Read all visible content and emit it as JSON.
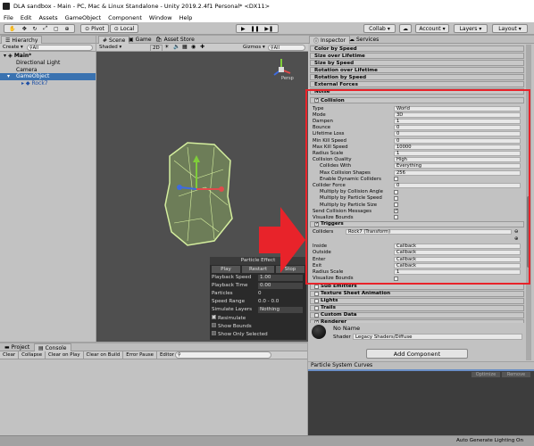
{
  "window_title": "DLA sandbox - Main - PC, Mac & Linux Standalone - Unity 2019.2.4f1 Personal* <DX11>",
  "menu": [
    "File",
    "Edit",
    "Assets",
    "GameObject",
    "Component",
    "Window",
    "Help"
  ],
  "toolbar": {
    "pivot": "Pivot",
    "local": "Local",
    "collab": "Collab",
    "account": "Account",
    "layers": "Layers",
    "layout": "Layout"
  },
  "hierarchy": {
    "tab": "Hierarchy",
    "create": "Create",
    "search": "All",
    "scene": "Main*",
    "items": [
      "Directional Light",
      "Camera",
      "GameObject",
      "Rock7"
    ]
  },
  "scene_tabs": {
    "scene": "Scene",
    "game": "Game",
    "asset_store": "Asset Store",
    "shaded": "Shaded",
    "mode": "2D",
    "gizmos": "Gizmos",
    "search": "All",
    "persp": "Persp"
  },
  "particle_panel": {
    "title": "Particle Effect",
    "play": "Play",
    "restart": "Restart",
    "stop": "Stop",
    "rows": [
      {
        "label": "Playback Speed",
        "value": "1.00"
      },
      {
        "label": "Playback Time",
        "value": "0.00"
      },
      {
        "label": "Particles",
        "value": "0"
      },
      {
        "label": "Speed Range",
        "value": "0.0 - 0.0"
      },
      {
        "label": "Simulate Layers",
        "value": "Nothing"
      }
    ],
    "checks": [
      {
        "label": "Resimulate",
        "on": true
      },
      {
        "label": "Show Bounds",
        "on": false
      },
      {
        "label": "Show Only Selected",
        "on": false
      }
    ]
  },
  "inspector": {
    "tab": "Inspector",
    "services": "Services",
    "modules_top": [
      "Color by Speed",
      "Size over Lifetime",
      "Size by Speed",
      "Rotation over Lifetime",
      "Rotation by Speed",
      "External Forces",
      "Noise"
    ],
    "collision_title": "Collision",
    "collision_rows": [
      {
        "label": "Type",
        "value": "World"
      },
      {
        "label": "Mode",
        "value": "3D"
      },
      {
        "label": "Dampen",
        "value": "1"
      },
      {
        "label": "Bounce",
        "value": "0"
      },
      {
        "label": "Lifetime Loss",
        "value": "0"
      },
      {
        "label": "Min Kill Speed",
        "value": "0"
      },
      {
        "label": "Max Kill Speed",
        "value": "10000"
      },
      {
        "label": "Radius Scale",
        "value": "1"
      },
      {
        "label": "Collision Quality",
        "value": "High"
      },
      {
        "label": "Collides With",
        "value": "Everything"
      },
      {
        "label": "Max Collision Shapes",
        "value": "256"
      },
      {
        "label": "Enable Dynamic Colliders",
        "value": ""
      },
      {
        "label": "Collider Force",
        "value": "0"
      },
      {
        "label": "Multiply by Collision Angle",
        "value": ""
      },
      {
        "label": "Multiply by Particle Speed",
        "value": ""
      },
      {
        "label": "Multiply by Particle Size",
        "value": ""
      },
      {
        "label": "Send Collision Messages",
        "value": ""
      },
      {
        "label": "Visualize Bounds",
        "value": ""
      }
    ],
    "triggers_title": "Triggers",
    "colliders_label": "Colliders",
    "colliders_value": "Rock7 (Transform)",
    "trigger_rows": [
      {
        "label": "Inside",
        "value": "Callback"
      },
      {
        "label": "Outside",
        "value": "Callback"
      },
      {
        "label": "Enter",
        "value": "Callback"
      },
      {
        "label": "Exit",
        "value": "Callback"
      },
      {
        "label": "Radius Scale",
        "value": "1"
      },
      {
        "label": "Visualize Bounds",
        "value": ""
      }
    ],
    "modules_bottom": [
      "Sub Emitters",
      "Texture Sheet Animation",
      "Lights",
      "Trails",
      "Custom Data",
      "Renderer"
    ],
    "material_name": "No Name",
    "shader_label": "Shader",
    "shader_value": "Legacy Shaders/Diffuse",
    "add_component": "Add Component"
  },
  "curves": {
    "title": "Particle System Curves",
    "optimize": "Optimize",
    "remove": "Remove"
  },
  "project": {
    "tab": "Project",
    "console": "Console",
    "buttons": [
      "Clear",
      "Collapse",
      "Clear on Play",
      "Clear on Build",
      "Error Pause",
      "Editor"
    ]
  },
  "status": "Auto Generate Lighting On",
  "colors": {
    "highlight": "#e8232a",
    "arrow": "#e8232a"
  }
}
